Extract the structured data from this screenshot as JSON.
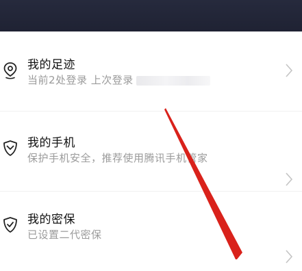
{
  "menu": {
    "items": [
      {
        "title": "我的足迹",
        "subtitle": "当前2处登录 上次登录",
        "icon": "location-pin-icon"
      },
      {
        "title": "我的手机",
        "subtitle": "保护手机安全，推荐使用腾讯手机管家",
        "icon": "shield-icon"
      },
      {
        "title": "我的密保",
        "subtitle": "已设置二代密保",
        "icon": "shield-check-icon"
      }
    ]
  },
  "colors": {
    "header": "#232638",
    "title": "#111111",
    "subtitle": "#9b9b9b",
    "chevron": "#c4c4c4",
    "annotation_arrow": "#d9221b"
  }
}
